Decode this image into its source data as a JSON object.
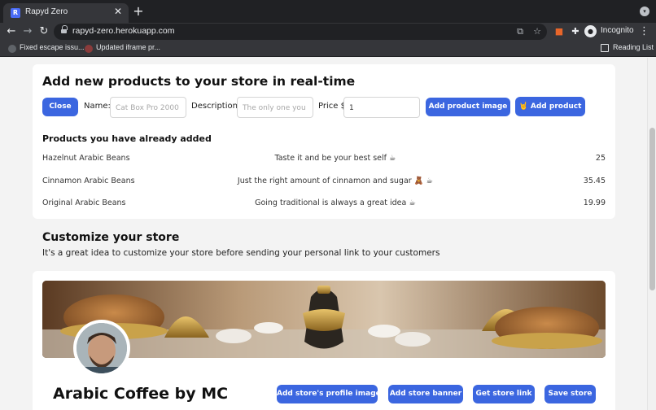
{
  "browser": {
    "tab_title": "Rapyd Zero",
    "tab_close": "✕",
    "new_tab": "+",
    "url": "rapyd-zero.herokuapp.com",
    "profile_label": "Incognito",
    "bookmarks": [
      {
        "label": "Fixed escape issu..."
      },
      {
        "label": "Updated iframe pr..."
      }
    ],
    "reading_list": "Reading List",
    "icons": {
      "back": "back-arrow-icon",
      "forward": "forward-arrow-icon",
      "reload": "reload-icon",
      "lock": "lock-icon",
      "translate": "translate-icon",
      "star": "star-icon",
      "extension_fox": "fox-extension-icon",
      "extensions": "puzzle-icon",
      "menu": "kebab-menu-icon"
    }
  },
  "add_products": {
    "title": "Add new products to your store in real-time",
    "close_label": "Close",
    "name_label": "Name:",
    "name_placeholder": "Cat Box Pro 2000",
    "description_label": "Description:",
    "description_placeholder": "The only one you w",
    "price_label": "Price $",
    "price_value": "1",
    "add_image_label": "Add product image",
    "add_product_label": "🤘 Add product",
    "list_title": "Products you have already added",
    "products": [
      {
        "name": "Hazelnut Arabic Beans",
        "description": "Taste it and be your best self ☕",
        "price": "25"
      },
      {
        "name": "Cinnamon Arabic Beans",
        "description": "Just the right amount of cinnamon and sugar 🧸 ☕",
        "price": "35.45"
      },
      {
        "name": "Original Arabic Beans",
        "description": "Going traditional is always a great idea ☕",
        "price": "19.99"
      }
    ]
  },
  "customize": {
    "title": "Customize your store",
    "subtitle": "It's a great idea to customize your store before sending your personal link to your customers",
    "store_name": "Arabic Coffee by MC",
    "buttons": {
      "profile_image": "Add store's profile image",
      "banner": "Add store banner",
      "link": "Get store link",
      "save": "Save store"
    }
  },
  "colors": {
    "accent": "#3b66e0",
    "chrome_dark": "#202124",
    "chrome_mid": "#35363a",
    "page_bg": "#f3f3f3"
  }
}
